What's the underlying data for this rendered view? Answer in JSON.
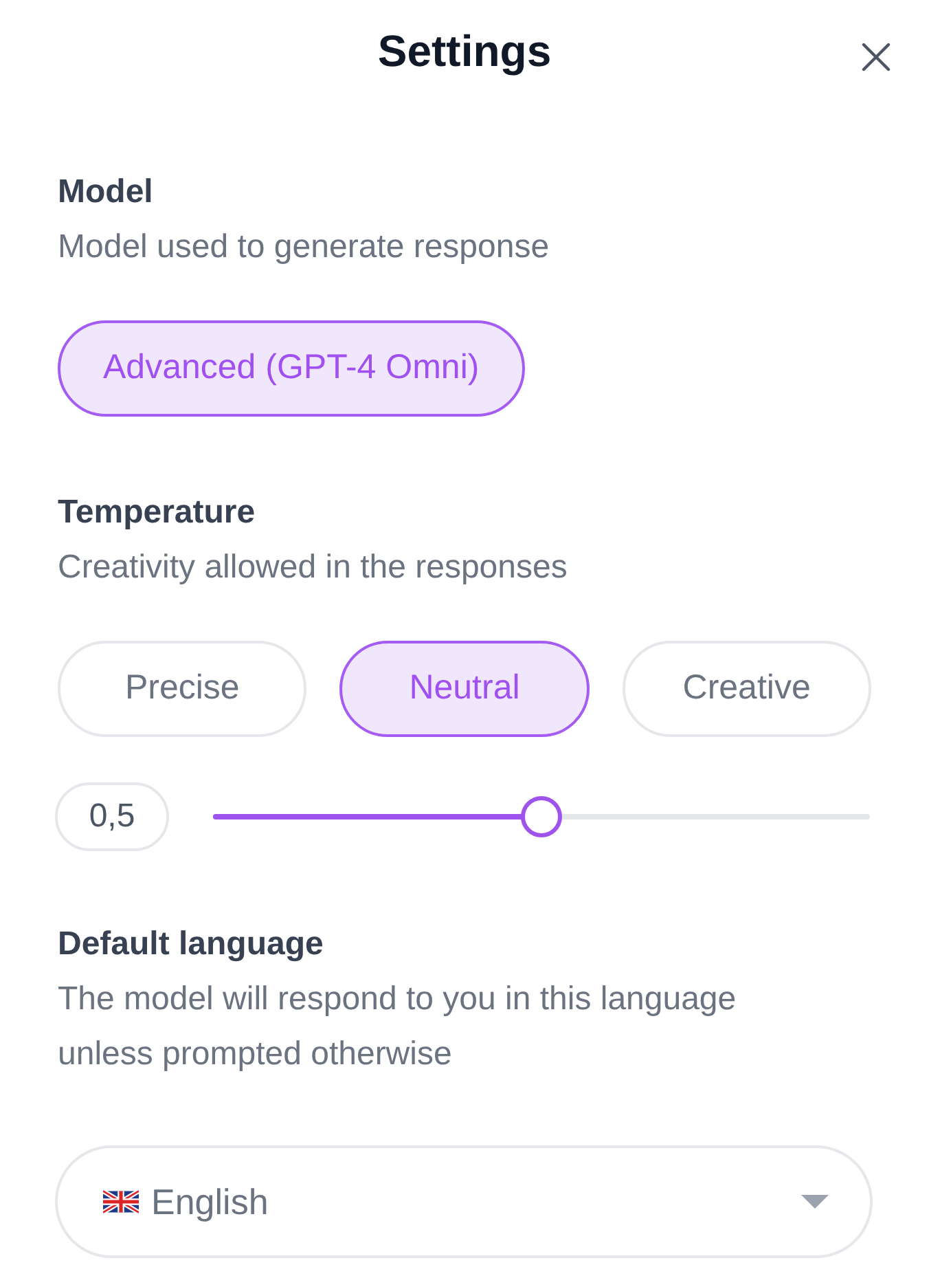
{
  "window": {
    "title": "Settings"
  },
  "model": {
    "heading": "Model",
    "description": "Model used to generate response",
    "options": [
      {
        "label": "Advanced (GPT-4 Omni)",
        "selected": true
      }
    ]
  },
  "temperature": {
    "heading": "Temperature",
    "description": "Creativity allowed in the responses",
    "presets": [
      {
        "label": "Precise",
        "selected": false
      },
      {
        "label": "Neutral",
        "selected": true
      },
      {
        "label": "Creative",
        "selected": false
      }
    ],
    "slider": {
      "value": "0,5",
      "level": 0.5
    }
  },
  "default_language": {
    "heading": "Default language",
    "description": "The model will respond to you in this language unless prompted otherwise",
    "select": {
      "value": "English"
    }
  }
}
